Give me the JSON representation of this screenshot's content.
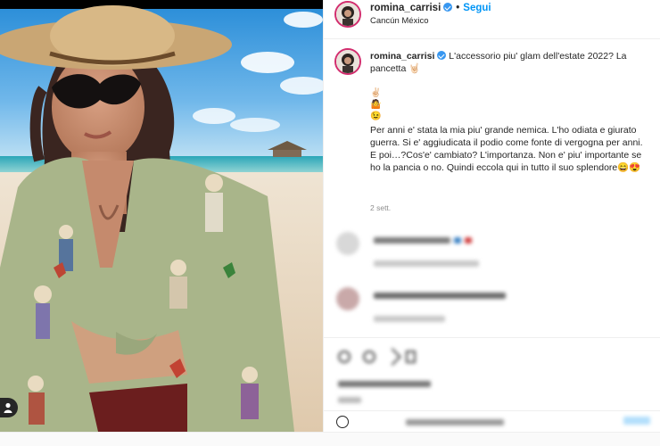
{
  "post": {
    "username": "romina_carrisi",
    "follow_label": "Segui",
    "separator": "•",
    "location": "Cancún México",
    "caption_line1": "L'accessorio piu' glam dell'estate 2022? La pancetta ",
    "emoji_hand": "🤘🏻",
    "emoji_1": "✌🏻",
    "emoji_2": "🤷",
    "emoji_3": "😉",
    "caption_paragraph": "Per anni e' stata la mia piu' grande nemica. L'ho odiata e giurato guerra. Si e' aggiudicata il podio come fonte di vergogna per anni. E poi…?Cos'e' cambiato? L'importanza. Non e' piu' importante se ho la pancia o no. Quindi eccola qui in tutto il suo splendore",
    "caption_end_emoji": "😄😍",
    "time": "2 sett."
  },
  "colors": {
    "accent": "#0095f6",
    "verified": "#3897f0",
    "story_ring": "#d22d6e",
    "shirt": "#a9b58a"
  },
  "icons": [
    "verified-badge-icon",
    "user-tag-icon",
    "smiley-icon"
  ]
}
